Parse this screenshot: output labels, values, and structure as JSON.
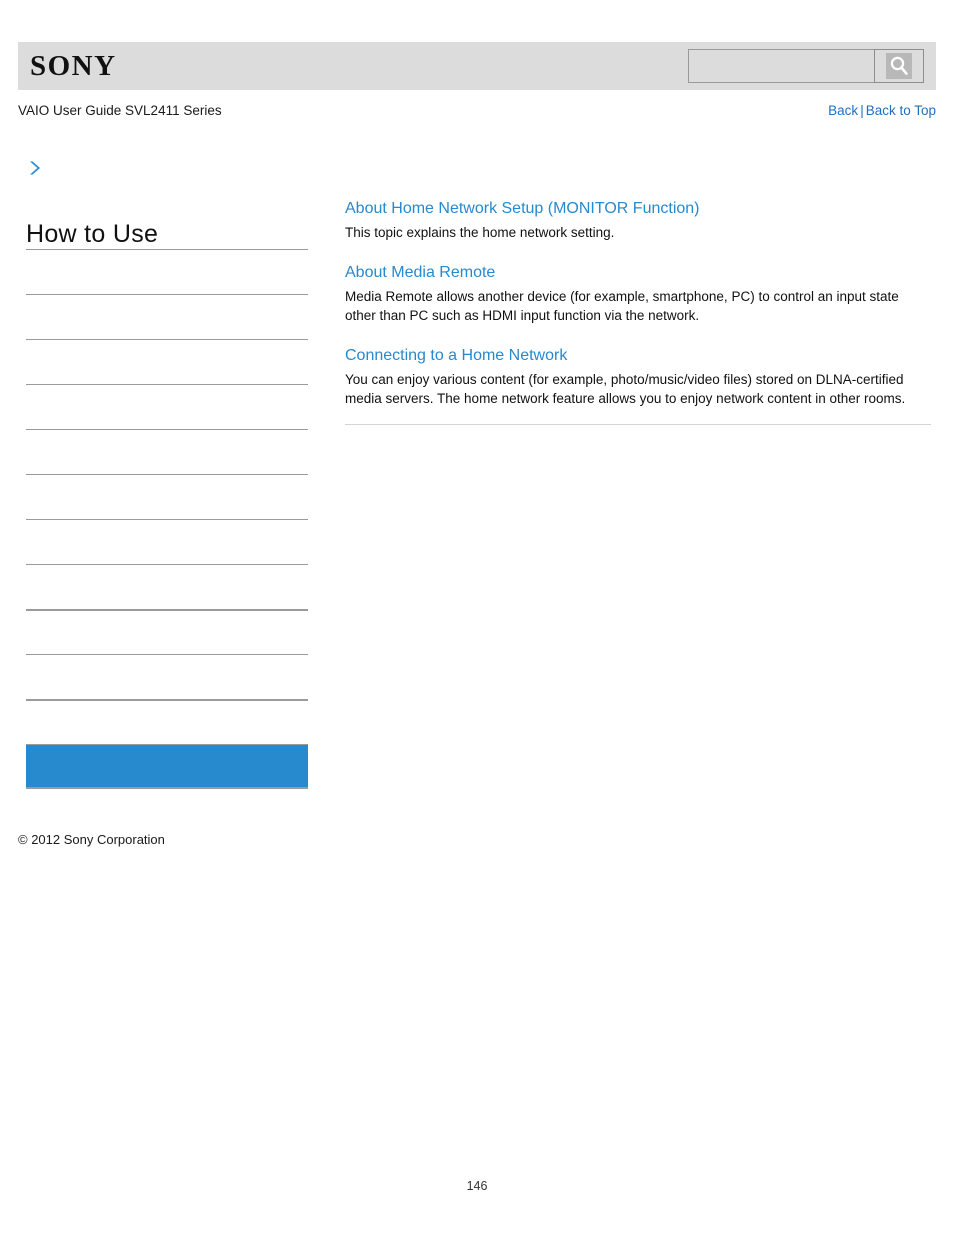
{
  "header": {
    "logo_text": "SONY",
    "search": {
      "value": "",
      "placeholder": "",
      "icon": "search-icon"
    }
  },
  "subheader": {
    "guide_title": "VAIO User Guide SVL2411 Series",
    "nav": {
      "back_label": "Back",
      "separator": "|",
      "back_to_top_label": "Back to Top"
    }
  },
  "sidebar": {
    "breadcrumb_icon": "chevron-right-icon",
    "section_title": "How to Use",
    "items": [
      {
        "label": "",
        "thick": false,
        "selected": false
      },
      {
        "label": "",
        "thick": false,
        "selected": false
      },
      {
        "label": "",
        "thick": false,
        "selected": false
      },
      {
        "label": "",
        "thick": false,
        "selected": false
      },
      {
        "label": "",
        "thick": false,
        "selected": false
      },
      {
        "label": "",
        "thick": false,
        "selected": false
      },
      {
        "label": "",
        "thick": false,
        "selected": false
      },
      {
        "label": "",
        "thick": false,
        "selected": false
      },
      {
        "label": "",
        "thick": true,
        "selected": false
      },
      {
        "label": "",
        "thick": false,
        "selected": false
      },
      {
        "label": "",
        "thick": true,
        "selected": false
      },
      {
        "label": "",
        "thick": false,
        "selected": true
      }
    ],
    "copyright": "© 2012 Sony Corporation"
  },
  "main": {
    "topics": [
      {
        "title": "About Home Network Setup (MONITOR Function)",
        "description": "This topic explains the home network setting."
      },
      {
        "title": "About Media Remote",
        "description": "Media Remote allows another device (for example, smartphone, PC) to control an input state other than PC such as HDMI input function via the network."
      },
      {
        "title": "Connecting to a Home Network",
        "description": "You can enjoy various content (for example, photo/music/video files) stored on DLNA-certified media servers. The home network feature allows you to enjoy network content in other rooms."
      }
    ]
  },
  "footer": {
    "page_number": "146"
  },
  "colors": {
    "brand_bar": "#dcdcdc",
    "link_blue": "#2789ce",
    "nav_link_blue": "#1f6fbf",
    "selected_blue": "#2789ce",
    "divider_gray": "#9b9b9b",
    "content_rule_gray": "#d4d4d4"
  }
}
